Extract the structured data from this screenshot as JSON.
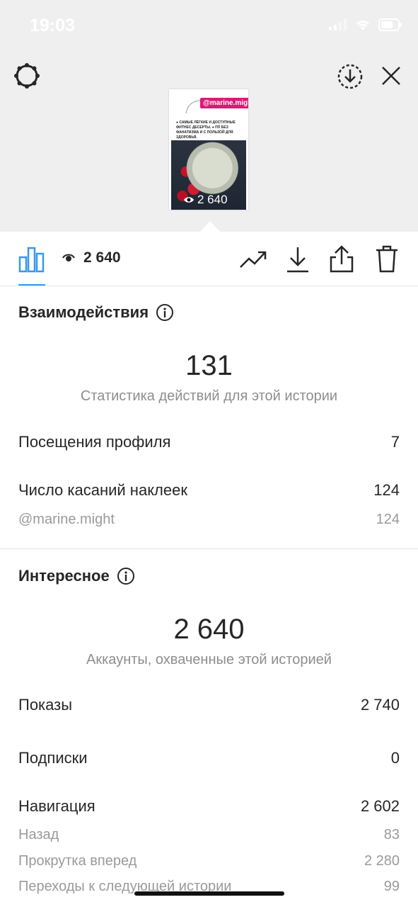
{
  "status_bar": {
    "time": "19:03"
  },
  "story_thumb": {
    "handle": "@marine.might",
    "text": "● САМЫЕ ЛЁГКИЕ И ДОСТУПНЫЕ ФИТНЕС ДЕСЕРТЫ. ● ПП БЕЗ ФАНАТИЗМА И С ПОЛЬЗОЙ ДЛЯ ЗДОРОВЬЯ.",
    "views": "2 640"
  },
  "toolbar": {
    "views": "2 640"
  },
  "interactions": {
    "title": "Взаимодействия",
    "total": "131",
    "subtitle": "Статистика действий для этой истории",
    "rows": [
      {
        "label": "Посещения профиля",
        "value": "7"
      },
      {
        "label": "Число касаний наклеек",
        "value": "124"
      }
    ],
    "sub_rows": [
      {
        "label": "@marine.might",
        "value": "124"
      }
    ]
  },
  "discovery": {
    "title": "Интересное",
    "total": "2 640",
    "subtitle": "Аккаунты, охваченные этой историей",
    "rows": [
      {
        "label": "Показы",
        "value": "2 740"
      },
      {
        "label": "Подписки",
        "value": "0"
      },
      {
        "label": "Навигация",
        "value": "2 602"
      }
    ],
    "sub_rows": [
      {
        "label": "Назад",
        "value": "83"
      },
      {
        "label": "Прокрутка вперед",
        "value": "2 280"
      },
      {
        "label": "Переходы к следующей истории",
        "value": "99"
      }
    ]
  }
}
